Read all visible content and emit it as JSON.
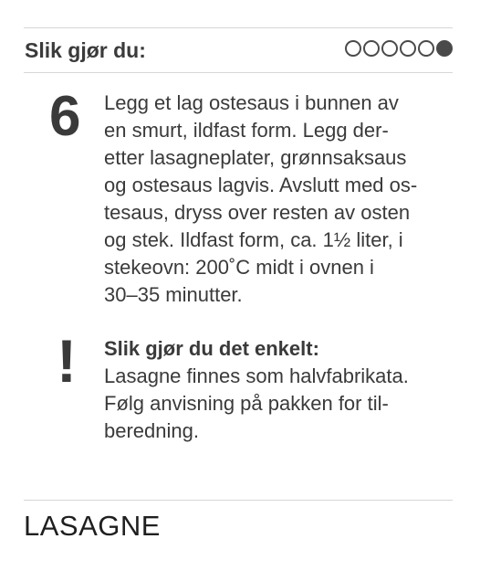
{
  "header": {
    "title": "Slik gjør du:",
    "progress": {
      "total": 6,
      "current": 6
    }
  },
  "step": {
    "number": "6",
    "lines": [
      "Legg et lag ostesaus i bunnen av",
      "en smurt, ildfast form. Legg der-",
      "etter lasagneplater, grønnsaksaus",
      "og ostesaus lagvis. Avslutt med os-",
      "tesaus, dryss over resten av osten",
      "og stek. Ildfast form, ca. 1½ liter, i",
      "stekeovn: 200˚C midt i ovnen i",
      "30–35 minutter."
    ]
  },
  "tip": {
    "icon": "!",
    "title": "Slik gjør du det enkelt:",
    "lines": [
      "Lasagne finnes som halvfabrikata.",
      "Følg anvisning på pakken for til-",
      "beredning."
    ]
  },
  "recipe": {
    "title": "LASAGNE"
  },
  "colors": {
    "text": "#3a3a3a",
    "rule": "#d6d6d6",
    "dot": "#4a4a4a"
  }
}
